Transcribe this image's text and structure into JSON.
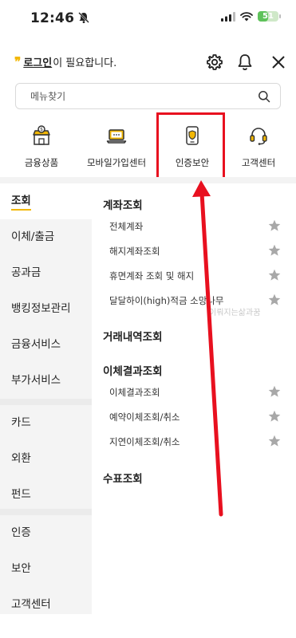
{
  "status_bar": {
    "time": "12:46",
    "battery": "51",
    "battery_level": 0.51
  },
  "header": {
    "login_link": "로그인",
    "login_suffix": "이 필요합니다."
  },
  "search": {
    "placeholder": "메뉴찾기"
  },
  "quick_menu": [
    {
      "label": "금융상품",
      "icon": "shop-icon"
    },
    {
      "label": "모바일가입센터",
      "icon": "laptop-icon"
    },
    {
      "label": "인증보안",
      "icon": "shield-phone-icon"
    },
    {
      "label": "고객센터",
      "icon": "headset-icon"
    }
  ],
  "left_nav": [
    "조회",
    "이체/출금",
    "공과금",
    "뱅킹정보관리",
    "금융서비스",
    "부가서비스",
    "카드",
    "외환",
    "펀드",
    "인증",
    "보안",
    "고객센터"
  ],
  "sections": [
    {
      "title": "계좌조회",
      "items": [
        "전체계좌",
        "해지계좌조회",
        "휴면계좌 조회 및 해지",
        "달달하이(high)적금 소망나무"
      ]
    },
    {
      "title": "거래내역조회",
      "items": []
    },
    {
      "title": "이체결과조회",
      "items": [
        "이체결과조회",
        "예약이체조회/취소",
        "지연이체조회/취소"
      ]
    },
    {
      "title": "수표조회",
      "items": []
    }
  ],
  "watermark": "이뤄지는삶과꿈",
  "colors": {
    "accent": "#f2b705",
    "highlight": "#e8101f"
  }
}
